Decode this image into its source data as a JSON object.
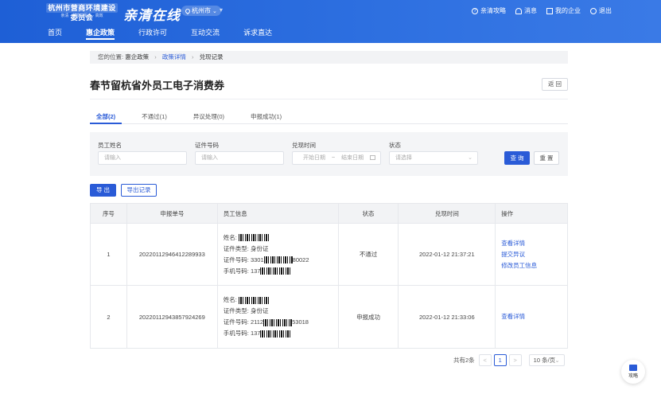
{
  "header": {
    "logo_text": "杭州市营商环境建设委员会",
    "logo_sub": "亲清 · 共享 · 服务 · 高效",
    "brand": "亲清在线",
    "city": "杭州市",
    "actions": [
      {
        "label": "亲清攻略",
        "icon": "question-circle-icon"
      },
      {
        "label": "消息",
        "icon": "bell-icon"
      },
      {
        "label": "我的企业",
        "icon": "building-icon"
      },
      {
        "label": "退出",
        "icon": "power-icon"
      }
    ]
  },
  "nav": {
    "items": [
      "首页",
      "惠企政策",
      "行政许可",
      "互动交流",
      "诉求直达"
    ],
    "active_index": 1
  },
  "breadcrumb": {
    "prefix": "您的位置:",
    "items": [
      "惠企政策",
      "政策详情",
      "兑现记录"
    ]
  },
  "page": {
    "title": "春节留杭省外员工电子消费券",
    "back_label": "返 回"
  },
  "tabs": [
    {
      "label": "全部(2)",
      "active": true
    },
    {
      "label": "不通过(1)",
      "active": false
    },
    {
      "label": "异议处理(0)",
      "active": false
    },
    {
      "label": "申报成功(1)",
      "active": false
    }
  ],
  "filter": {
    "name_label": "员工姓名",
    "name_placeholder": "请输入",
    "id_label": "证件号码",
    "id_placeholder": "请输入",
    "time_label": "兑现时间",
    "start_placeholder": "开始日期",
    "range_sep": "~",
    "end_placeholder": "结束日期",
    "status_label": "状态",
    "status_placeholder": "请选择",
    "query_label": "查 询",
    "reset_label": "重 置"
  },
  "toolbar": {
    "export_label": "导 出",
    "export_records_label": "导出记录"
  },
  "table": {
    "headers": [
      "序号",
      "申报单号",
      "员工信息",
      "状态",
      "兑现时间",
      "操作"
    ],
    "info_labels": {
      "name": "姓名:",
      "id_type": "证件类型:",
      "id_no": "证件号码:",
      "phone": "手机号码:"
    },
    "rows": [
      {
        "index": "1",
        "order_no": "20220112946412289933",
        "id_type": "身份证",
        "id_prefix": "3301",
        "id_suffix": "80022",
        "phone_prefix": "137",
        "status": "不通过",
        "time": "2022-01-12 21:37:21",
        "actions": [
          "查看详情",
          "提交异议",
          "修改员工信息"
        ]
      },
      {
        "index": "2",
        "order_no": "20220112943857924269",
        "id_type": "身份证",
        "id_prefix": "2112",
        "id_suffix": "53018",
        "phone_prefix": "137",
        "status": "申报成功",
        "time": "2022-01-12 21:33:06",
        "actions": [
          "查看详情"
        ]
      }
    ]
  },
  "pagination": {
    "total": "共有2条",
    "prev": "<",
    "current": "1",
    "next": ">",
    "page_size": "10 条/页"
  },
  "float_button": {
    "label": "攻略"
  }
}
